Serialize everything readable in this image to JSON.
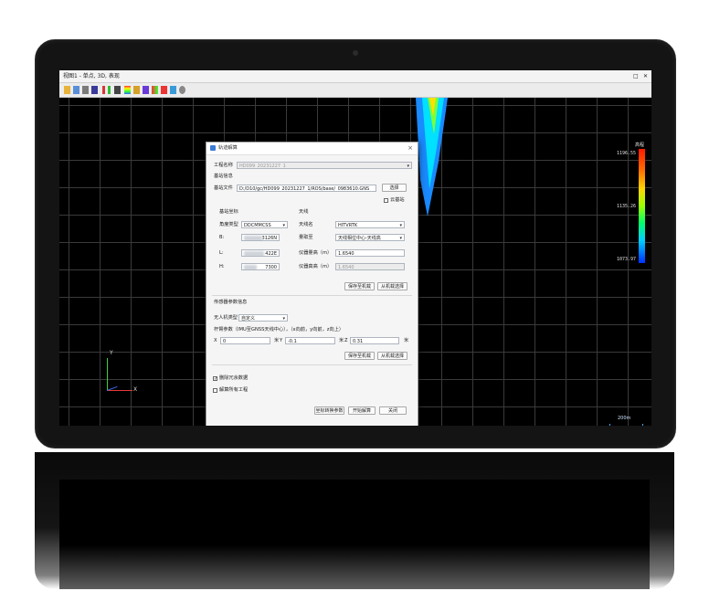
{
  "window": {
    "title": "视图1 - 单点, 3D, 表现",
    "controls": [
      "□",
      "✕"
    ]
  },
  "toolbar": {
    "icons": [
      "open-icon",
      "save-icon",
      "print-icon",
      "layers-icon",
      "chart-icon",
      "ruler-icon",
      "color-icon",
      "palette-icon",
      "grid-icon",
      "settings-icon"
    ]
  },
  "colors": {
    "accent": "#3a7bd5",
    "screen_bg": "#000000",
    "grid": "#3a3a3a"
  },
  "viewport": {
    "colorbar": {
      "title": "高程",
      "max": "1196.55",
      "mid": "1135.26",
      "min": "1073.97"
    },
    "axes": {
      "x": "X",
      "y": "Y"
    },
    "scale_label": "200m"
  },
  "dialog": {
    "title": "轨迹解算",
    "project_name_label": "工程名称",
    "project_name_value": "HD099_20231227_1",
    "base_section": "基站信息",
    "base_file_label": "基站文件",
    "base_file_value": "D:/D10/gc/HD099_20231227_1/ROS/base/_0983610.GNS",
    "browse_label": "选择",
    "cloud_base_label": "云基站",
    "base_coord_section": "基站坐标",
    "angle_type_label": "角度类型",
    "angle_type_value": "DDCMMCSS",
    "b_label": "B:",
    "b_value": "3126N",
    "l_label": "L:",
    "l_value": "422E",
    "h_label": "H:",
    "h_value": "7300",
    "antenna_section": "天线",
    "antenna_name_label": "天线名",
    "antenna_name_value": "HITVRTK",
    "measure_to_label": "量取至",
    "measure_to_value": "天线相位中心-天线高",
    "instrument_height_label": "仪器量高（m）",
    "instrument_height_value": "1.6540",
    "instrument_true_label": "仪器真高（m）",
    "instrument_true_value": "1.6540",
    "save_to_device_label": "保存至机载",
    "select_from_device_label": "从机载选择",
    "sensor_section": "传感器参数信息",
    "uav_type_label": "无人机类型",
    "uav_type_value": "自定义",
    "lever_label": "杆臂参数（IMU至GNSS天线中心），（x向前，y向前，z向上）",
    "x_label": "X",
    "x_value": "0",
    "x_unit": "米",
    "y_label": "Y",
    "y_value": "-0.1",
    "y_unit": "米",
    "z_label": "Z",
    "z_value": "0.31",
    "z_unit": "米",
    "save_to_device2_label": "保存至机载",
    "select_from_device2_label": "从机载选择",
    "delete_redundant_label": "删除冗余数据",
    "solve_all_label": "解算所有工程",
    "coord_param_label": "坐标转换参数",
    "start_label": "开始解算",
    "close_label": "关闭"
  }
}
